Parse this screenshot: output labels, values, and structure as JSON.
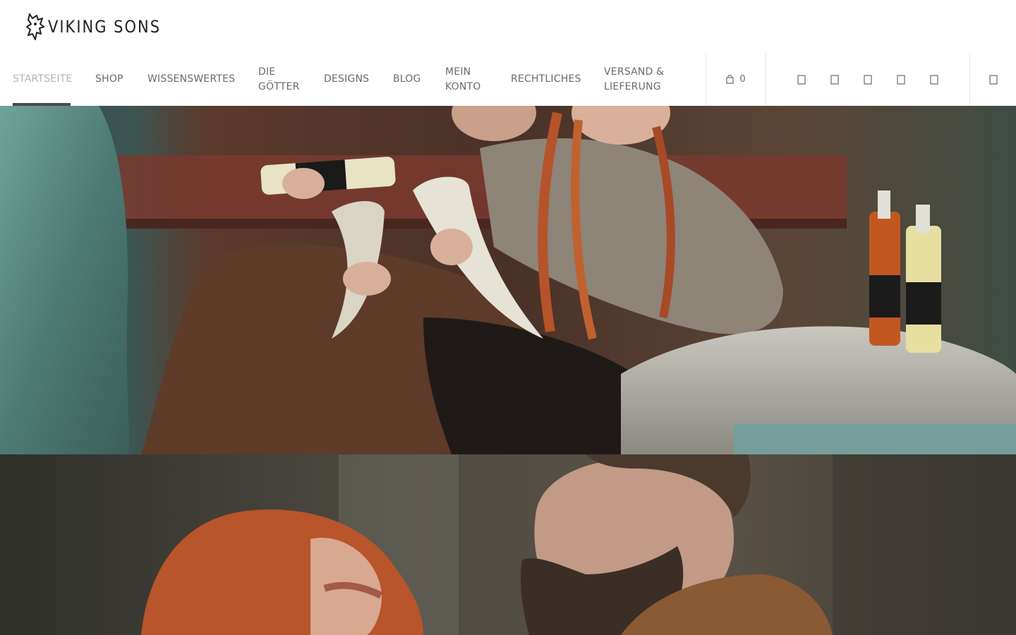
{
  "brand": {
    "logo_text": "VIKING SONS",
    "logo_icon": "wolf-head-icon"
  },
  "nav": {
    "items": [
      {
        "label_line1": "STARTSEITE",
        "label_line2": "",
        "active": true
      },
      {
        "label_line1": "SHOP",
        "label_line2": ""
      },
      {
        "label_line1": "WISSENSWERTES",
        "label_line2": ""
      },
      {
        "label_line1": "DIE",
        "label_line2": "GÖTTER"
      },
      {
        "label_line1": "DESIGNS",
        "label_line2": ""
      },
      {
        "label_line1": "BLOG",
        "label_line2": ""
      },
      {
        "label_line1": "MEIN",
        "label_line2": "KONTO"
      },
      {
        "label_line1": "RECHTLICHES",
        "label_line2": ""
      },
      {
        "label_line1": "VERSAND &",
        "label_line2": "LIEFERUNG"
      }
    ],
    "active_color": "#b4b4b4",
    "text_color": "#6b6b6b",
    "indicator_color": "#4a4a4a"
  },
  "cart": {
    "icon": "shopping-bag-icon",
    "count": "0"
  },
  "social_icons": [
    "facebook-icon",
    "instagram-icon",
    "pinterest-icon",
    "youtube-icon",
    "twitter-icon"
  ],
  "search_icon": "search-icon"
}
